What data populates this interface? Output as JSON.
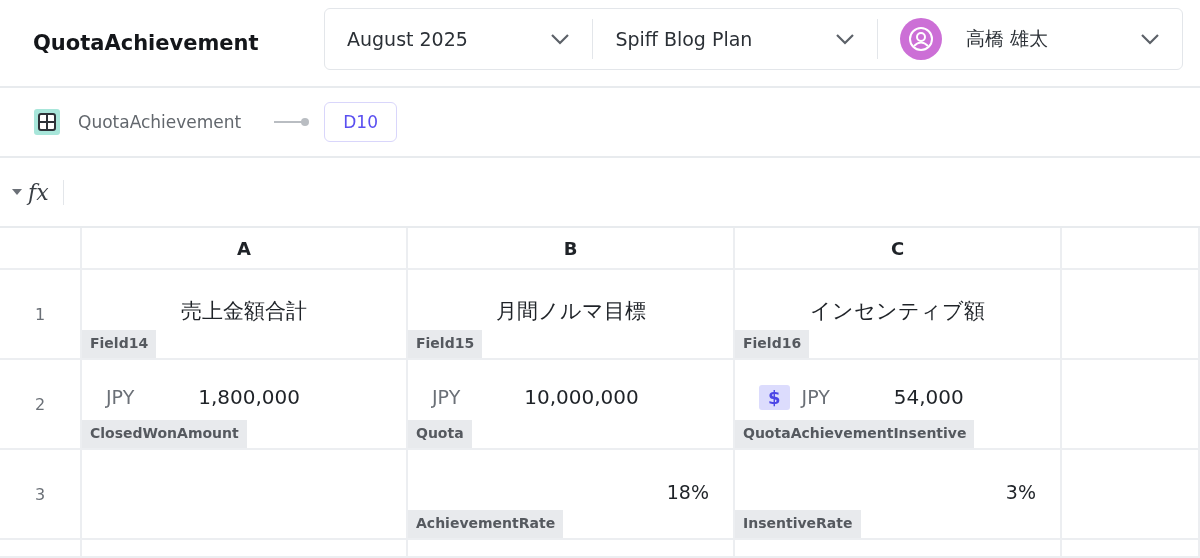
{
  "header": {
    "title": "QuotaAchievement",
    "selectors": [
      {
        "kind": "text",
        "label": "August 2025"
      },
      {
        "kind": "text",
        "label": "Spiff Blog Plan"
      },
      {
        "kind": "user",
        "label": "高橋 雄太"
      }
    ]
  },
  "breadcrumb": {
    "table": "QuotaAchievement",
    "cell": "D10"
  },
  "formula_bar": {
    "fx": "fx"
  },
  "sheet": {
    "columns": [
      "A",
      "B",
      "C"
    ],
    "rows": [
      {
        "number": "1",
        "cells": [
          {
            "kind": "label",
            "text": "売上金額合計",
            "tag": "Field14"
          },
          {
            "kind": "label",
            "text": "月間ノルマ目標",
            "tag": "Field15"
          },
          {
            "kind": "label",
            "text": "インセンティブ額",
            "tag": "Field16"
          }
        ]
      },
      {
        "number": "2",
        "cells": [
          {
            "kind": "currency",
            "currency": "JPY",
            "value": "1,800,000",
            "tag": "ClosedWonAmount"
          },
          {
            "kind": "currency",
            "currency": "JPY",
            "value": "10,000,000",
            "tag": "Quota"
          },
          {
            "kind": "currency",
            "badge": "$",
            "currency": "JPY",
            "value": "54,000",
            "tag": "QuotaAchievementInsentive"
          }
        ]
      },
      {
        "number": "3",
        "cells": [
          {
            "kind": "empty"
          },
          {
            "kind": "percent",
            "value": "18%",
            "tag": "AchievementRate"
          },
          {
            "kind": "percent",
            "value": "3%",
            "tag": "InsentiveRate"
          }
        ]
      }
    ]
  }
}
